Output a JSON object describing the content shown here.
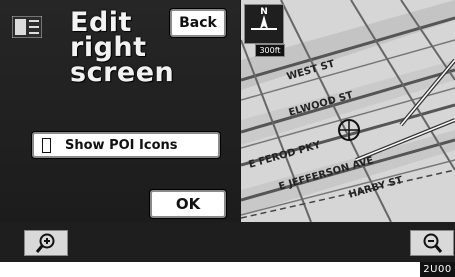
{
  "header": {
    "title": "Edit\nright\nscreen",
    "back_label": "Back"
  },
  "options": {
    "show_poi_label": "Show POI Icons",
    "ok_label": "OK"
  },
  "map": {
    "compass_letter": "N",
    "scale_text": "300ft",
    "streets": [
      "WEST ST",
      "ELWOOD ST",
      "E FEROD PKY",
      "E JEFFERSON AVE",
      "HARBY ST"
    ]
  },
  "footer": {
    "image_code": "2U00"
  },
  "icons": [
    "menu-list-icon",
    "compass-icon",
    "zoom-in-icon",
    "zoom-out-icon",
    "position-marker-icon"
  ]
}
